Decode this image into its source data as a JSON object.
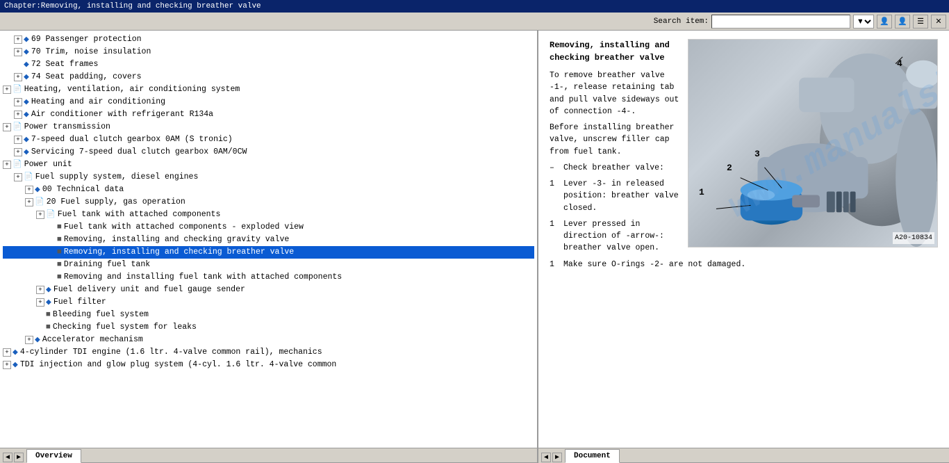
{
  "titleBar": {
    "text": "Chapter:Removing, installing and checking breather valve"
  },
  "toolbar": {
    "searchLabel": "Search item:",
    "searchPlaceholder": ""
  },
  "tree": {
    "items": [
      {
        "id": 1,
        "indent": 1,
        "type": "expandable",
        "icon": "blue-diamond",
        "text": "69 Passenger protection"
      },
      {
        "id": 2,
        "indent": 1,
        "type": "expandable",
        "icon": "blue-diamond",
        "text": "70 Trim, noise insulation"
      },
      {
        "id": 3,
        "indent": 1,
        "type": "leaf",
        "icon": "blue-diamond",
        "text": "72 Seat frames"
      },
      {
        "id": 4,
        "indent": 1,
        "type": "expandable",
        "icon": "blue-diamond",
        "text": "74 Seat padding, covers"
      },
      {
        "id": 5,
        "indent": 0,
        "type": "expandable",
        "icon": "book",
        "text": "Heating, ventilation, air conditioning system"
      },
      {
        "id": 6,
        "indent": 1,
        "type": "expandable",
        "icon": "blue-diamond",
        "text": "Heating and air conditioning"
      },
      {
        "id": 7,
        "indent": 1,
        "type": "expandable",
        "icon": "blue-diamond",
        "text": "Air conditioner with refrigerant R134a"
      },
      {
        "id": 8,
        "indent": 0,
        "type": "expandable",
        "icon": "book",
        "text": "Power transmission"
      },
      {
        "id": 9,
        "indent": 1,
        "type": "expandable",
        "icon": "blue-diamond",
        "text": "7-speed dual clutch gearbox 0AM (S tronic)"
      },
      {
        "id": 10,
        "indent": 1,
        "type": "expandable",
        "icon": "blue-diamond",
        "text": "Servicing 7-speed dual clutch gearbox 0AM/0CW"
      },
      {
        "id": 11,
        "indent": 0,
        "type": "expandable",
        "icon": "book",
        "text": "Power unit"
      },
      {
        "id": 12,
        "indent": 1,
        "type": "expandable",
        "icon": "book",
        "text": "Fuel supply system, diesel engines"
      },
      {
        "id": 13,
        "indent": 2,
        "type": "expandable",
        "icon": "blue-diamond",
        "text": "00 Technical data"
      },
      {
        "id": 14,
        "indent": 2,
        "type": "expandable",
        "icon": "book",
        "text": "20 Fuel supply, gas operation"
      },
      {
        "id": 15,
        "indent": 3,
        "type": "expandable",
        "icon": "book",
        "text": "Fuel tank with attached components"
      },
      {
        "id": 16,
        "indent": 4,
        "type": "doc",
        "text": "Fuel tank with attached components - exploded view"
      },
      {
        "id": 17,
        "indent": 4,
        "type": "doc",
        "text": "Removing, installing and checking gravity valve"
      },
      {
        "id": 18,
        "indent": 4,
        "type": "doc",
        "text": "Removing, installing and checking breather valve",
        "selected": true
      },
      {
        "id": 19,
        "indent": 4,
        "type": "doc",
        "text": "Draining fuel tank"
      },
      {
        "id": 20,
        "indent": 4,
        "type": "doc",
        "text": "Removing and installing fuel tank with attached components"
      },
      {
        "id": 21,
        "indent": 3,
        "type": "expandable",
        "icon": "blue-diamond",
        "text": "Fuel delivery unit and fuel gauge sender"
      },
      {
        "id": 22,
        "indent": 3,
        "type": "expandable",
        "icon": "blue-diamond",
        "text": "Fuel filter"
      },
      {
        "id": 23,
        "indent": 3,
        "type": "doc",
        "text": "Bleeding fuel system"
      },
      {
        "id": 24,
        "indent": 3,
        "type": "doc",
        "text": "Checking fuel system for leaks"
      },
      {
        "id": 25,
        "indent": 2,
        "type": "expandable",
        "icon": "blue-diamond",
        "text": "Accelerator mechanism"
      },
      {
        "id": 26,
        "indent": 0,
        "type": "expandable",
        "icon": "blue-diamond",
        "text": "4-cylinder TDI engine (1.6 ltr. 4-valve common rail), mechanics"
      },
      {
        "id": 27,
        "indent": 0,
        "type": "expandable",
        "icon": "blue-diamond",
        "text": "TDI injection and glow plug system (4-cyl. 1.6 ltr. 4-valve common"
      }
    ]
  },
  "document": {
    "title": "Removing, installing and\nchecking breather valve",
    "paragraphs": [
      {
        "type": "text",
        "content": "To remove breather valve -1-, release retaining tab and pull valve sideways out of connection -4-."
      },
      {
        "type": "text",
        "content": "Before installing breather valve, unscrew filler cap from fuel tank."
      },
      {
        "type": "bullet",
        "marker": "–",
        "content": "Check breather valve:"
      },
      {
        "type": "numbered",
        "marker": "1",
        "content": "Lever -3- in released position: breather valve closed."
      },
      {
        "type": "numbered",
        "marker": "1",
        "content": "Lever pressed in direction of -arrow-: breather valve open."
      },
      {
        "type": "numbered",
        "marker": "1",
        "content": "Make sure O-rings -2- are not damaged."
      }
    ],
    "imageLabel": "A20-10834",
    "imageNumbers": [
      "1",
      "2",
      "3",
      "4"
    ]
  },
  "tabs": {
    "left": [
      {
        "label": "Overview",
        "active": true
      }
    ],
    "right": [
      {
        "label": "Document",
        "active": true
      }
    ]
  }
}
